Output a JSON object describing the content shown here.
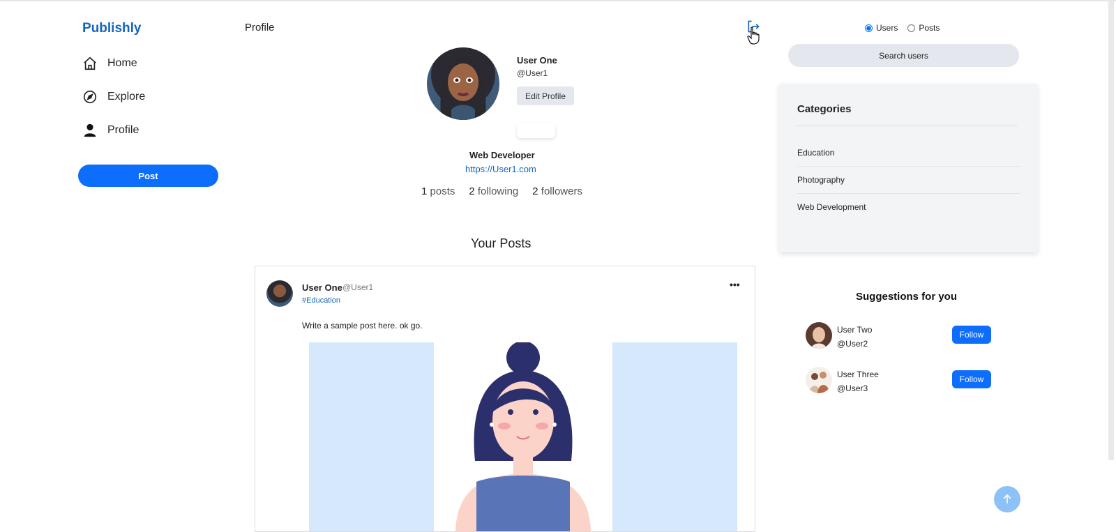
{
  "app": {
    "brand": "Publishly"
  },
  "nav": {
    "items": [
      {
        "label": "Home",
        "icon": "home-icon"
      },
      {
        "label": "Explore",
        "icon": "compass-icon"
      },
      {
        "label": "Profile",
        "icon": "person-icon"
      }
    ],
    "post_button": "Post"
  },
  "header": {
    "title": "Profile",
    "logout_icon": "logout-icon"
  },
  "profile": {
    "name": "User One",
    "handle": "@User1",
    "edit_label": "Edit Profile",
    "bio": "Web Developer",
    "website": "https://User1.com",
    "stats": {
      "posts_count": "1",
      "posts_label": "posts",
      "following_count": "2",
      "following_label": "following",
      "followers_count": "2",
      "followers_label": "followers"
    }
  },
  "posts_section": {
    "title": "Your Posts"
  },
  "post": {
    "author": "User One",
    "handle": "@User1",
    "tag": "#Education",
    "text": "Write a sample post here. ok go.",
    "more": "•••"
  },
  "search": {
    "options": [
      "Users",
      "Posts"
    ],
    "selected": "Users",
    "placeholder": "Search users"
  },
  "categories": {
    "title": "Categories",
    "items": [
      "Education",
      "Photography",
      "Web Development"
    ]
  },
  "suggestions": {
    "title": "Suggestions for you",
    "users": [
      {
        "name": "User Two",
        "handle": "@User2",
        "button": "Follow"
      },
      {
        "name": "User Three",
        "handle": "@User3",
        "button": "Follow"
      }
    ]
  },
  "colors": {
    "accent": "#0d6efd",
    "brand": "#1565c0",
    "panel": "#f3f4f6"
  }
}
